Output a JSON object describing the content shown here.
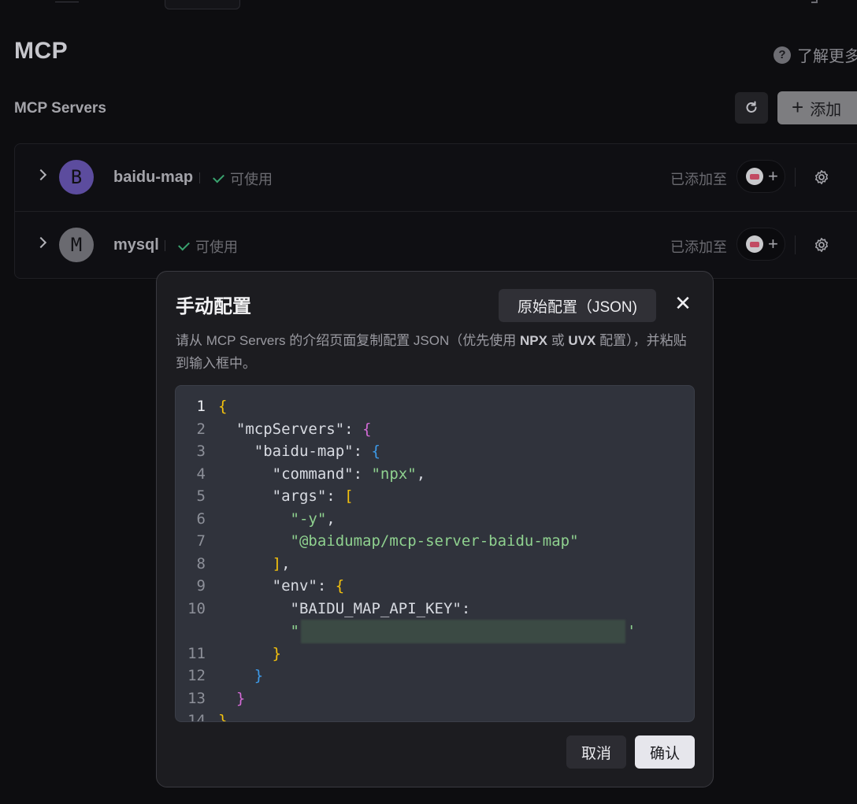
{
  "page": {
    "title": "MCP",
    "learn_more": "了解更多",
    "section_title": "MCP Servers",
    "add_button": "添加"
  },
  "servers": [
    {
      "initial": "B",
      "name": "baidu-map",
      "status": "可使用",
      "added_to": "已添加至",
      "avatar_color": "#5c4c9e"
    },
    {
      "initial": "M",
      "name": "mysql",
      "status": "可使用",
      "added_to": "已添加至",
      "avatar_color": "#6a6a70"
    }
  ],
  "modal": {
    "title": "手动配置",
    "raw_button": "原始配置（JSON)",
    "close_symbol": "✕",
    "desc_part1": "请从 MCP Servers 的介绍页面复制配置 JSON（优先使用 ",
    "desc_npx": "NPX",
    "desc_or": " 或 ",
    "desc_uvx": "UVX",
    "desc_part2": " 配置），并粘贴到输入框中。",
    "cancel": "取消",
    "confirm": "确认"
  },
  "code": {
    "line_numbers": [
      "1",
      "2",
      "3",
      "4",
      "5",
      "6",
      "7",
      "8",
      "9",
      "10",
      "11",
      "12",
      "13",
      "14"
    ],
    "l1": "{",
    "k_mcpServers": "\"mcpServers\"",
    "k_baidu": "\"baidu-map\"",
    "k_command": "\"command\"",
    "v_command": "\"npx\"",
    "k_args": "\"args\"",
    "v_arg1": "\"-y\"",
    "v_arg2": "\"@baidumap/mcp-server-baidu-map\"",
    "k_env": "\"env\"",
    "k_apikey": "\"BAIDU_MAP_API_KEY\"",
    "colon": ": ",
    "comma": ",",
    "open_brace": "{",
    "close_brace": "}",
    "open_bracket": "[",
    "close_bracket": "]",
    "quote": "\"",
    "apos": "'"
  },
  "colors": {
    "brace_yellow": "#f4c20d",
    "brace_purple": "#d36ad6",
    "brace_blue": "#3d9ae8",
    "string_green": "#8fd18f",
    "status_green": "#3aa36f"
  }
}
